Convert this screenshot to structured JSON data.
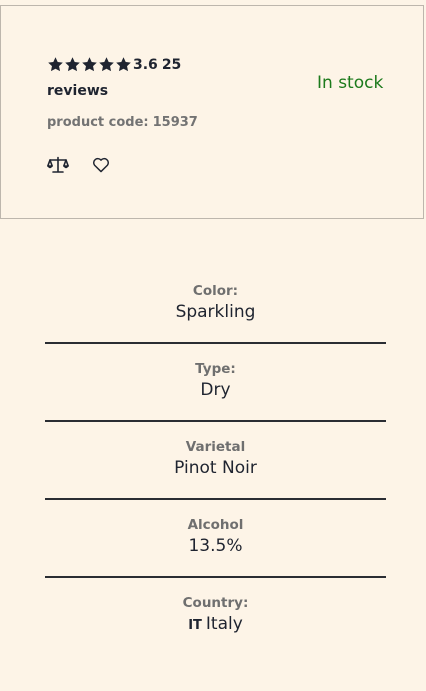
{
  "product": {
    "rating_value": "3.6",
    "rating_stars": 5,
    "review_count": "25",
    "reviews_word": "reviews",
    "product_code_label": "product code:",
    "product_code": "15937",
    "stock_status": "In stock",
    "stock_color": "#1c7a1c"
  },
  "icons": {
    "compare": "balance-scale-icon",
    "wishlist": "heart-outline-icon",
    "star": "star-icon"
  },
  "specs": [
    {
      "label": "Color:",
      "value": "Sparkling"
    },
    {
      "label": "Type:",
      "value": "Dry"
    },
    {
      "label": "Varietal",
      "value": "Pinot Noir"
    },
    {
      "label": "Alcohol",
      "value": "13.5%"
    },
    {
      "label": "Country:",
      "flag": "IT",
      "value": "Italy"
    }
  ]
}
